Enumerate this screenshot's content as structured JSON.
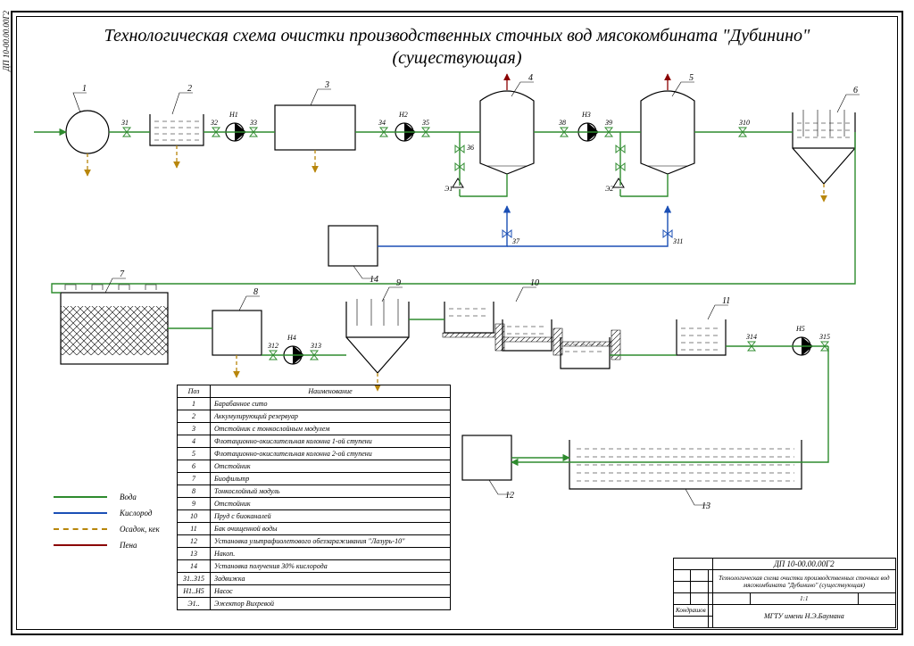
{
  "drawing_number": "ДП 10-00.00.00Г2",
  "title_line1": "Технологическая схема очистки производственных сточных вод мясокомбината \"Дубинино\"",
  "title_line2": "(существующая)",
  "legend": {
    "water": "Вода",
    "oxygen": "Кислород",
    "sludge": "Осадок, кек",
    "foam": "Пена"
  },
  "bom_header_pos": "Поз",
  "bom_header_name": "Наименование",
  "bom": [
    {
      "pos": "1",
      "name": "Барабанное сито"
    },
    {
      "pos": "2",
      "name": "Аккумулирующий резервуар"
    },
    {
      "pos": "3",
      "name": "Отстойник с тонкослойным модулем"
    },
    {
      "pos": "4",
      "name": "Флотационно-окислительная колонна 1-ой ступени"
    },
    {
      "pos": "5",
      "name": "Флотационно-окислительная колонна 2-ой ступени"
    },
    {
      "pos": "6",
      "name": "Отстойник"
    },
    {
      "pos": "7",
      "name": "Биофильтр"
    },
    {
      "pos": "8",
      "name": "Тонкослойный модуль"
    },
    {
      "pos": "9",
      "name": "Отстойник"
    },
    {
      "pos": "10",
      "name": "Пруд с биоканалей"
    },
    {
      "pos": "11",
      "name": "Бак очищенной воды"
    },
    {
      "pos": "12",
      "name": "Установка ультрафиолетового обеззараживания \"Лазурь-10\""
    },
    {
      "pos": "13",
      "name": "Накоп."
    },
    {
      "pos": "14",
      "name": "Установка получения 30% кислорода"
    },
    {
      "pos": "З1..З15",
      "name": "Задвижка"
    },
    {
      "pos": "Н1..Н5",
      "name": "Насос"
    },
    {
      "pos": "Э1..",
      "name": "Эжектор Вихревой"
    }
  ],
  "tags": {
    "n1": "1",
    "n2": "2",
    "n3": "3",
    "n4": "4",
    "n5": "5",
    "n6": "6",
    "n7": "7",
    "n8": "8",
    "n9": "9",
    "n10": "10",
    "n11": "11",
    "n12": "12",
    "n13": "13",
    "n14": "14",
    "H1": "Н1",
    "H2": "Н2",
    "H3": "Н3",
    "H4": "Н4",
    "H5": "Н5",
    "Z1": "З1",
    "Z2": "З2",
    "Z3": "З3",
    "Z4": "З4",
    "Z5": "З5",
    "Z6": "З6",
    "Z7": "З7",
    "Z8": "З8",
    "Z9": "З9",
    "Z10": "З10",
    "Z11": "З11",
    "Z12": "З12",
    "Z13": "З13",
    "Z14": "З14",
    "Z15": "З15",
    "E1": "Э1",
    "E2": "Э2"
  },
  "stamp": {
    "project": "Технологическая схема очистки производственных сточных вод мясокомбината \"Дубинино\" (существующая)",
    "org": "МГТУ имени Н.Э.Баумана",
    "sheet": "1:1",
    "doc": "ДП 10-00.00.00Г2",
    "author": "Кондрашов"
  }
}
